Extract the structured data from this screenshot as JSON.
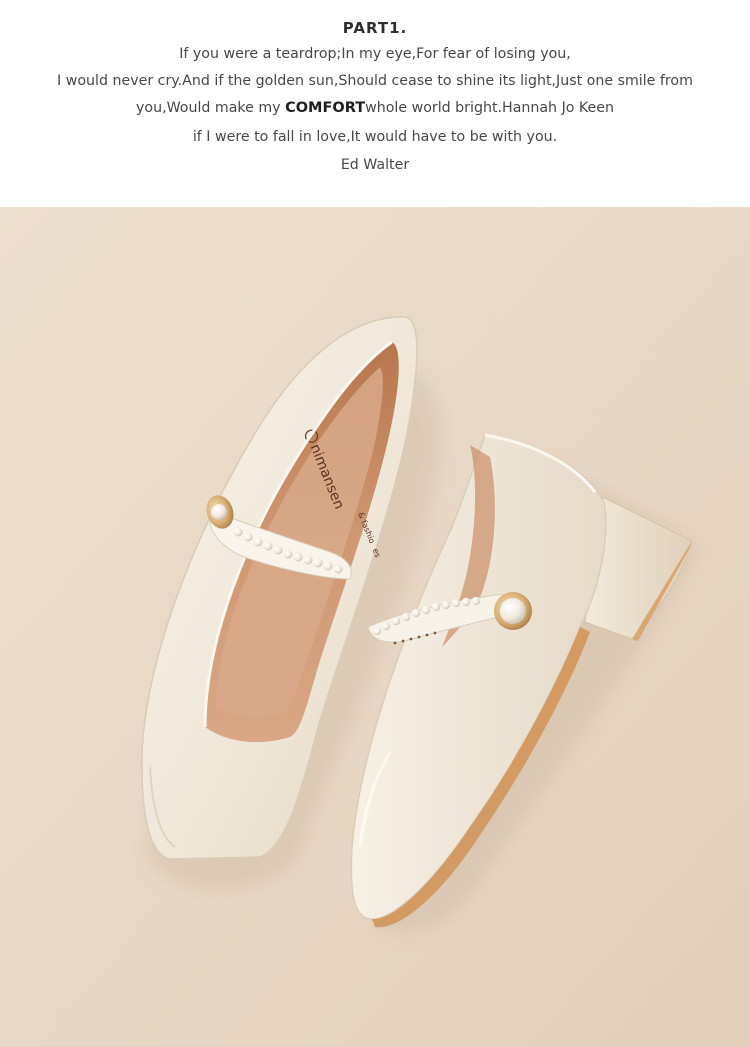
{
  "text_section": {
    "heading": "PART1.",
    "line1": "If you were a teardrop;In my eye,For fear of losing you,",
    "line2": "I would never cry.And if the golden sun,Should cease to shine its light,Just one smile from",
    "line3_before": "you,Would make my ",
    "line3_emphasis": "COMFORT",
    "line3_after": "whole world bright.Hannah Jo Keen",
    "line4": "if I were to fall in love,It would have to be with you.",
    "line5": "Ed Walter"
  },
  "photo": {
    "insole_brand": "nimansen",
    "insole_tagline": "& fashio",
    "insole_tagline_tail": "es",
    "background_color": "#e8d8c6",
    "shoe_color": "#f3ece0",
    "lining_color": "#c98a60"
  }
}
